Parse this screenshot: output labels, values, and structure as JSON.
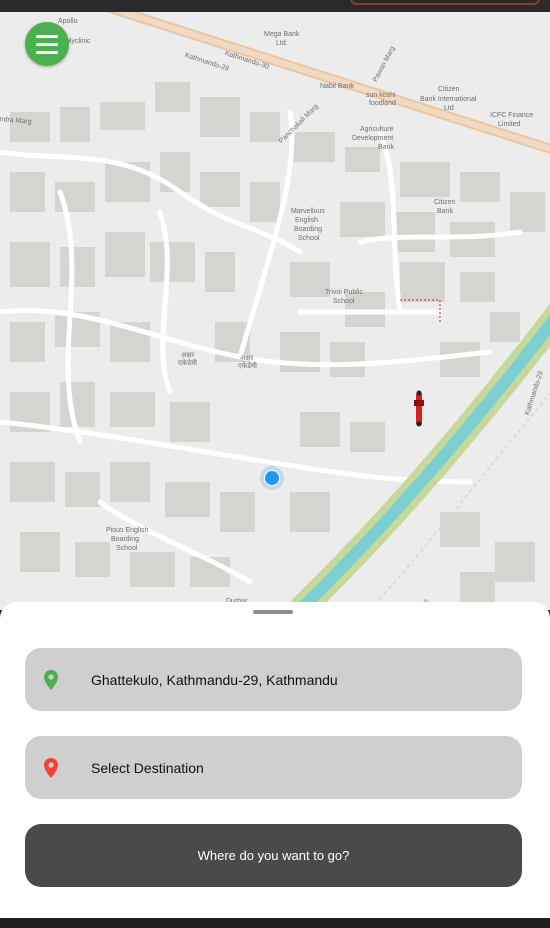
{
  "map": {
    "labels": {
      "apollo": "Apollo",
      "polyclinic": "olyclinic",
      "mega_bank": "Mega Bank",
      "ltd": "Ltd.",
      "kathmandu_30": "Kathmandu-30",
      "kathmandu_29_top": "Kathmandu-29",
      "nabil_bank": "Nabil Bank",
      "sun_koshi": "sun koshi",
      "foodland": "foodland",
      "citizen_bank_intl": "Citizen",
      "citizen_bank_intl2": "Bank International",
      "citizen_bank_intl3": "Ltd",
      "icfc": "ICFC Finance",
      "icfc2": "Limited",
      "pawan_marg": "Pawan Marg",
      "panchakali_marg": "Panchakali Marg",
      "agriculture": "Agriculture",
      "development": "Development",
      "bank": "Bank",
      "ndra_marg": "ndra Marg",
      "citizen_bank": "Citizen",
      "citizen_bank2": "Bank",
      "marvellous": "Marvellous",
      "english": "English",
      "boarding": "Boarding",
      "school": "School",
      "trivoi": "Trivoi Public",
      "trivoi2": "School",
      "akkhar1": "अक्षर",
      "akkhar2": "एकेडेमी",
      "akkhar3": "अक्षर",
      "akkhar4": "एकेडेमी",
      "kathmandu_29_right": "Kathmandu-29",
      "pious": "Pious English",
      "pious2": "Boarding",
      "pious3": "School",
      "kathmandu_10": "du-10",
      "durbar": "Durbar"
    }
  },
  "menu": {
    "icon": "hamburger-menu-icon"
  },
  "sheet": {
    "pickup": {
      "icon": "location-pin-green-icon",
      "text": "Ghattekulo, Kathmandu-29, Kathmandu"
    },
    "destination": {
      "icon": "location-pin-red-icon",
      "text": "Select Destination"
    },
    "go_button": "Where do you want to go?"
  },
  "colors": {
    "menu_button": "#4caf50",
    "pickup_pin": "#4caf50",
    "destination_pin": "#f44336",
    "go_button_bg": "#4a4a4a",
    "field_bg": "#cfcfcf",
    "user_location": "#2196f3"
  }
}
